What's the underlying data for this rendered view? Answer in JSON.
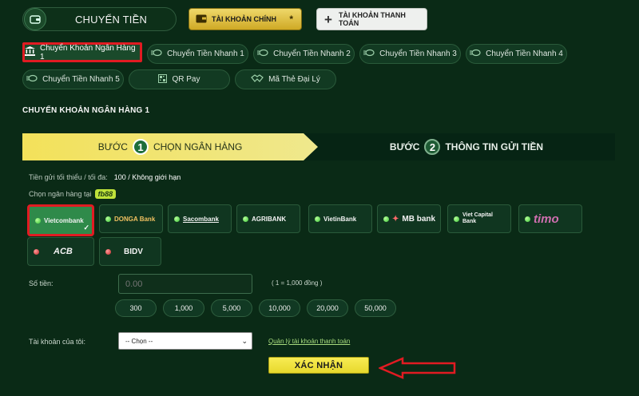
{
  "header": {
    "transfer_label": "CHUYỂN TIỀN",
    "main_account_label": "TÀI KHOẢN CHÍNH",
    "main_account_star": "*",
    "payment_account_label": "TÀI KHOẢN THANH TOÁN"
  },
  "methods": [
    {
      "label": "Chuyển Khoản Ngân Hàng 1",
      "icon": "bank-icon",
      "active": true
    },
    {
      "label": "Chuyển Tiền Nhanh 1",
      "icon": "fast-money-icon"
    },
    {
      "label": "Chuyển Tiền Nhanh 2",
      "icon": "fast-money-icon"
    },
    {
      "label": "Chuyển Tiền Nhanh 3",
      "icon": "fast-money-icon"
    },
    {
      "label": "Chuyển Tiền Nhanh 4",
      "icon": "fast-money-icon"
    },
    {
      "label": "Chuyển Tiền Nhanh 5",
      "icon": "fast-money-icon"
    },
    {
      "label": "QR Pay",
      "icon": "qr-icon"
    },
    {
      "label": "Mã Thẻ Đại Lý",
      "icon": "handshake-icon"
    }
  ],
  "section_title": "CHUYỂN KHOẢN NGÂN HÀNG 1",
  "steps": {
    "step1_prefix": "BƯỚC",
    "step1_num": "1",
    "step1_label": "CHỌN NGÂN HÀNG",
    "step2_prefix": "BƯỚC",
    "step2_num": "2",
    "step2_label": "THÔNG TIN GỬI TIỀN"
  },
  "limits": {
    "label": "Tiền gửi tối thiểu / tối đa:",
    "value": "100 / Không giới hạn"
  },
  "choose_bank": {
    "label": "Chọn ngân hàng tại",
    "brand": "fb88"
  },
  "banks": [
    {
      "name": "Vietcombank",
      "status": "green",
      "selected": true
    },
    {
      "name": "DONGA Bank",
      "status": "green"
    },
    {
      "name": "Sacombank",
      "status": "green"
    },
    {
      "name": "AGRIBANK",
      "status": "green"
    },
    {
      "name": "VietinBank",
      "status": "green"
    },
    {
      "name": "MB bank",
      "status": "green"
    },
    {
      "name": "Viet Capital Bank",
      "status": "green"
    },
    {
      "name": "timo",
      "status": "green"
    },
    {
      "name": "ACB",
      "status": "red"
    },
    {
      "name": "BIDV",
      "status": "red"
    }
  ],
  "amount": {
    "label": "Số tiền:",
    "placeholder": "0.00",
    "rate": "( 1 = 1,000 đồng )",
    "quick": [
      "300",
      "1,000",
      "5,000",
      "10,000",
      "20,000",
      "50,000"
    ]
  },
  "account": {
    "label": "Tài khoản của tôi:",
    "selected": "-- Chọn --",
    "manage_link": "Quản lý tài khoản thanh toán"
  },
  "confirm_label": "XÁC NHẬN",
  "colors": {
    "accent_yellow": "#f3e15a",
    "highlight_red": "#e11b22",
    "background": "#0a2a16"
  }
}
